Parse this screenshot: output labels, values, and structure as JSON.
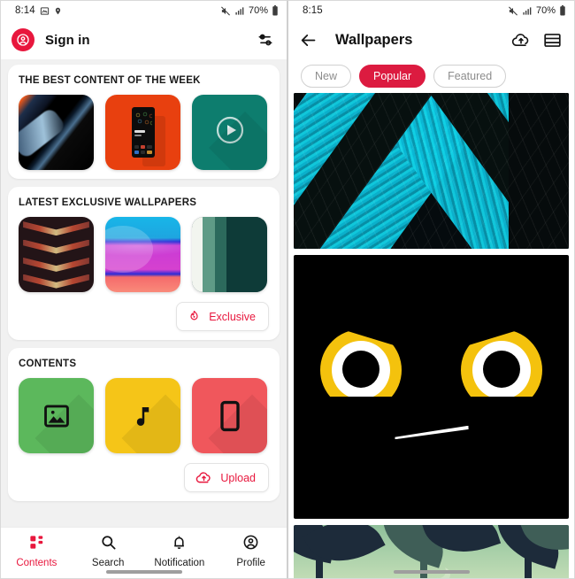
{
  "left_phone": {
    "status_bar": {
      "time": "8:14",
      "battery_percent": "70%",
      "icons": [
        "photo-icon",
        "location-pin-icon",
        "mute-icon",
        "signal-icon",
        "battery-icon"
      ]
    },
    "app_bar": {
      "title": "Sign in",
      "avatar_icon": "account-circle-icon",
      "action_icon": "tune-sliders-icon",
      "accent": "#e8173d"
    },
    "sections": [
      {
        "title": "THE BEST CONTENT OF THE WEEK",
        "tiles": [
          {
            "name": "dark-gradient-wallpaper",
            "style": "art-dark-diag",
            "icon": ""
          },
          {
            "name": "orange-phone-theme",
            "style": "art-orange",
            "icon": "phone-mockup"
          },
          {
            "name": "teal-video-tile",
            "style": "art-teal",
            "icon": "play-circle-icon"
          }
        ],
        "action": null
      },
      {
        "title": "LATEST EXCLUSIVE WALLPAPERS",
        "tiles": [
          {
            "name": "dark-chevron-wallpaper",
            "style": "art-chevdark",
            "icon": ""
          },
          {
            "name": "cyan-magenta-waves-wallpaper",
            "style": "art-waves",
            "icon": ""
          },
          {
            "name": "teal-curves-wallpaper",
            "style": "art-tealcurve",
            "icon": ""
          }
        ],
        "action": {
          "label": "Exclusive",
          "icon": "flame-icon",
          "color": "#e8173d"
        }
      },
      {
        "title": "CONTENTS",
        "tiles": [
          {
            "name": "wallpapers-category",
            "style": "art-solid",
            "color": "#5cb85c",
            "icon": "image-icon"
          },
          {
            "name": "ringtones-category",
            "style": "art-solid",
            "color": "#f5c518",
            "icon": "music-note-icon"
          },
          {
            "name": "themes-category",
            "style": "art-solid",
            "color": "#f0575c",
            "icon": "smartphone-icon"
          }
        ],
        "action": {
          "label": "Upload",
          "icon": "cloud-upload-icon",
          "color": "#e8173d"
        }
      }
    ],
    "bottom_nav": {
      "active": "Contents",
      "items": [
        {
          "label": "Contents",
          "icon": "grid-dashboard-icon"
        },
        {
          "label": "Search",
          "icon": "search-icon"
        },
        {
          "label": "Notification",
          "icon": "bell-icon"
        },
        {
          "label": "Profile",
          "icon": "account-circle-icon"
        }
      ]
    }
  },
  "right_phone": {
    "status_bar": {
      "time": "8:15",
      "battery_percent": "70%",
      "icons": [
        "mute-icon",
        "signal-icon",
        "battery-icon"
      ]
    },
    "app_bar": {
      "title": "Wallpapers",
      "back_icon": "arrow-back-icon",
      "upload_icon": "cloud-upload-icon",
      "layout_icon": "view-layout-icon"
    },
    "filter_chips": {
      "active": "Popular",
      "items": [
        "New",
        "Popular",
        "Featured"
      ],
      "active_color": "#dc1b40"
    },
    "wallpapers": [
      {
        "name": "cyan-chevron-rock-wallpaper",
        "style": "wp-chevron"
      },
      {
        "name": "angry-yellow-eyes-wallpaper",
        "style": "wp-eyes"
      },
      {
        "name": "green-palm-trees-wallpaper",
        "style": "wp-palms"
      }
    ]
  }
}
